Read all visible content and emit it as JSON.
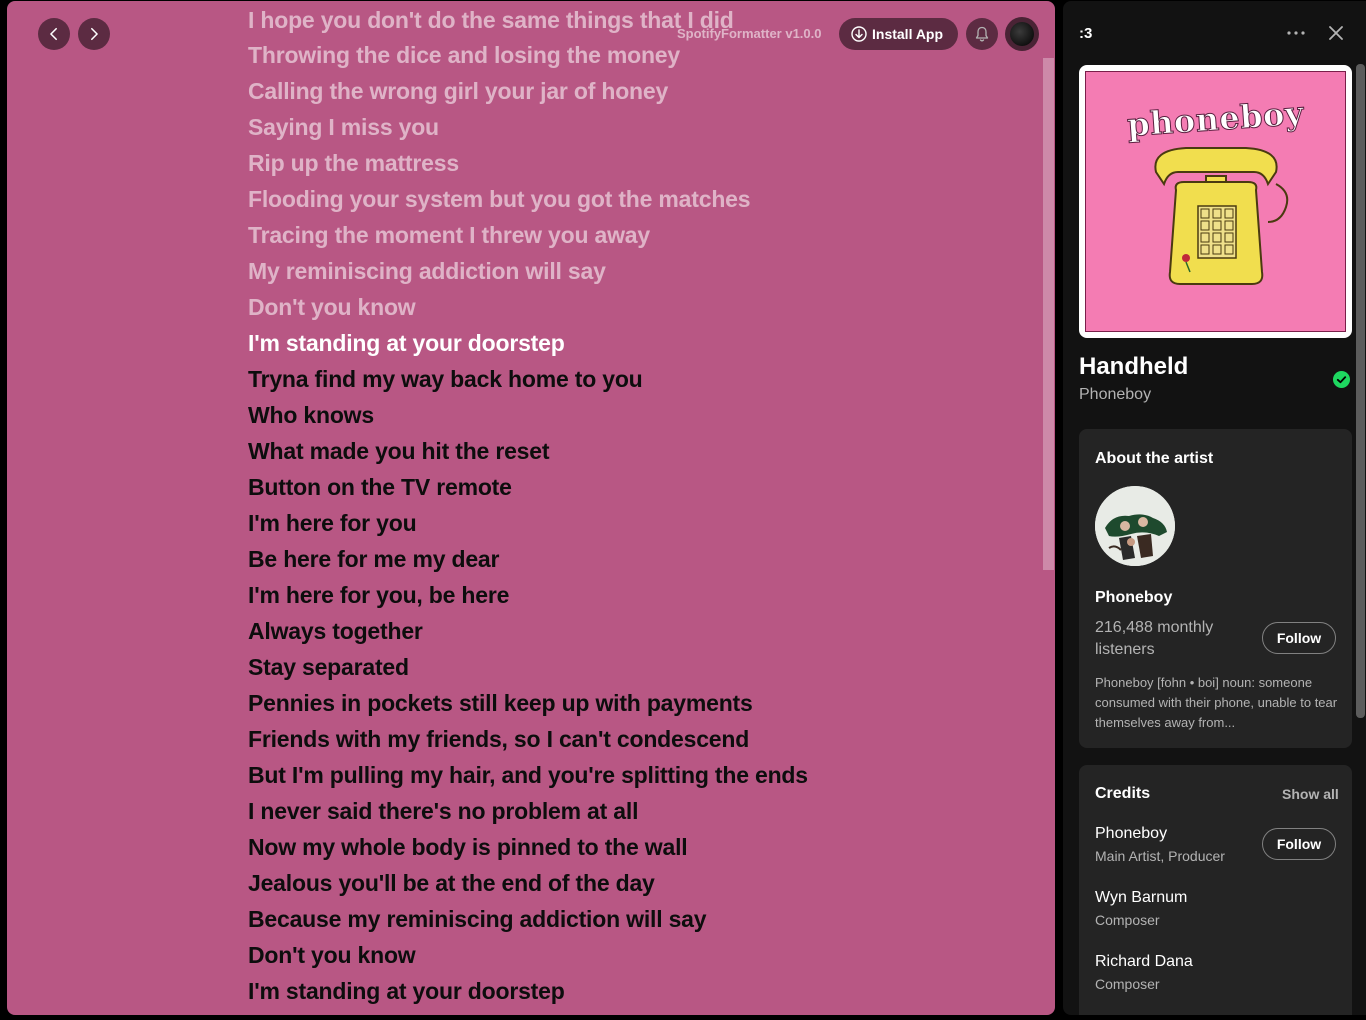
{
  "topbar": {
    "version_label": "SpotifyFormatter v1.0.0",
    "install_app_label": "Install App"
  },
  "lyrics": {
    "past_lines": [
      "I hope you don't do the same things that I did",
      "Throwing the dice and losing the money",
      "Calling the wrong girl your jar of honey",
      "Saying I miss you",
      "Rip up the mattress",
      "Flooding your system but you got the matches",
      "Tracing the moment I threw you away",
      "My reminiscing addiction will say",
      "Don't you know"
    ],
    "current_line": "I'm standing at your doorstep",
    "upcoming_lines": [
      "Tryna find my way back home to you",
      "Who knows",
      "What made you hit the reset",
      "Button on the TV remote",
      "I'm here for you",
      "Be here for me my dear",
      "I'm here for you, be here",
      "Always together",
      "Stay separated",
      "Pennies in pockets still keep up with payments",
      "Friends with my friends, so I can't condescend",
      "But I'm pulling my hair, and you're splitting the ends",
      "I never said there's no problem at all",
      "Now my whole body is pinned to the wall",
      "Jealous you'll be at the end of the day",
      "Because my reminiscing addiction will say",
      "Don't you know",
      "I'm standing at your doorstep"
    ],
    "background_color": "#b85784"
  },
  "sidebar": {
    "title": ":3",
    "album_art_text": "phoneboy",
    "track_title": "Handheld",
    "track_artist": "Phoneboy",
    "saved_color": "#1ed760",
    "about_artist": {
      "heading": "About the artist",
      "name": "Phoneboy",
      "monthly_listeners": "216,488 monthly listeners",
      "follow_label": "Follow",
      "bio": "Phoneboy [fohn • boi] noun: someone consumed with their phone, unable to tear themselves away from..."
    },
    "credits": {
      "heading": "Credits",
      "show_all_label": "Show all",
      "items": [
        {
          "name": "Phoneboy",
          "role": "Main Artist, Producer"
        },
        {
          "name": "Wyn Barnum",
          "role": "Composer"
        },
        {
          "name": "Richard Dana",
          "role": "Composer"
        }
      ],
      "follow_label": "Follow"
    }
  }
}
